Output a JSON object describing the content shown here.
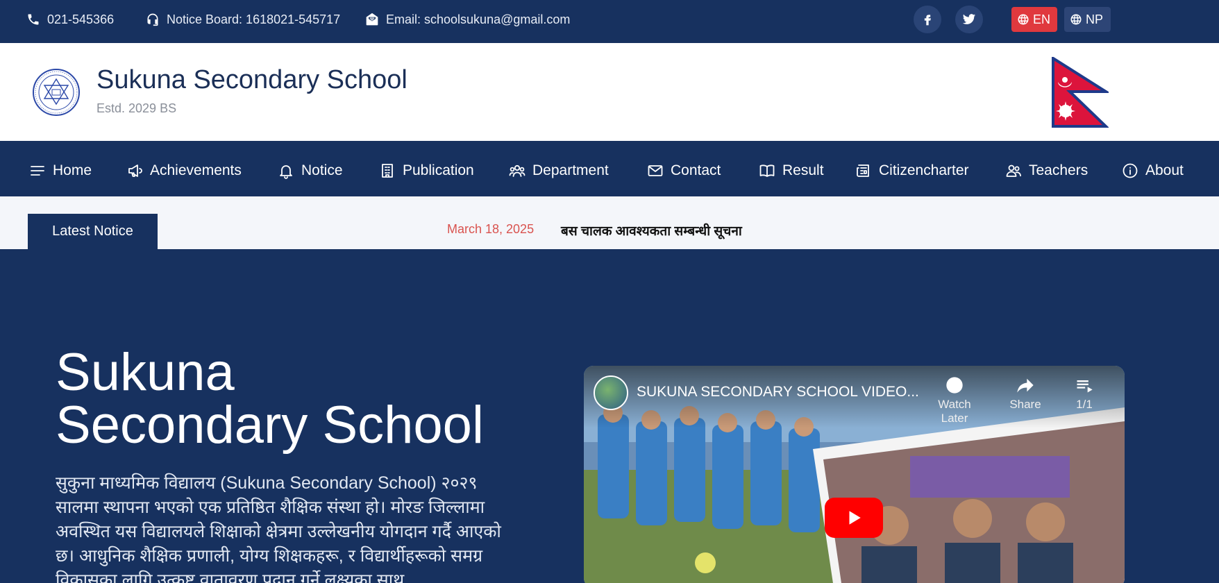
{
  "topbar": {
    "phone": "021-545366",
    "notice_board": "Notice Board: 1618021-545717",
    "email": "Email: schoolsukuna@gmail.com",
    "languages": [
      "EN",
      "NP"
    ]
  },
  "header": {
    "school_name": "Sukuna Secondary School",
    "estd": "Estd. 2029 BS"
  },
  "nav": {
    "items": [
      {
        "label": "Home",
        "icon": "menu-icon"
      },
      {
        "label": "Achievements",
        "icon": "megaphone-icon"
      },
      {
        "label": "Notice",
        "icon": "bell-icon"
      },
      {
        "label": "Publication",
        "icon": "building-icon"
      },
      {
        "label": "Department",
        "icon": "users-icon"
      },
      {
        "label": "Contact",
        "icon": "mail-icon"
      },
      {
        "label": "Result",
        "icon": "book-icon"
      },
      {
        "label": "Citizencharter",
        "icon": "newspaper-icon"
      },
      {
        "label": "Teachers",
        "icon": "user-group-icon"
      },
      {
        "label": "About",
        "icon": "info-icon"
      }
    ]
  },
  "notice": {
    "label": "Latest Notice",
    "date": "March 18, 2025",
    "title": "बस चालक आवश्यकता सम्बन्धी सूचना"
  },
  "hero": {
    "title_line1": "Sukuna",
    "title_line2": "Secondary School",
    "description": "सुकुना माध्यमिक विद्यालय (Sukuna Secondary School) २०२९ सालमा स्थापना भएको एक प्रतिष्ठित शैक्षिक संस्था हो। मोरङ जिल्लामा अवस्थित यस विद्यालयले शिक्षाको क्षेत्रमा उल्लेखनीय योगदान गर्दै आएको छ। आधुनिक शैक्षिक प्रणाली, योग्य शिक्षकहरू, र विद्यार्थीहरूको समग्र विकासका लागि उत्कृष्ट वातावरण प्रदान गर्ने लक्ष्यका साथ"
  },
  "video": {
    "title": "SUKUNA SECONDARY SCHOOL VIDEO...",
    "watch_later": "Watch Later",
    "share": "Share",
    "playlist_count": "1/1"
  },
  "colors": {
    "navy": "#17315f",
    "red": "#e0393e",
    "white": "#ffffff"
  }
}
